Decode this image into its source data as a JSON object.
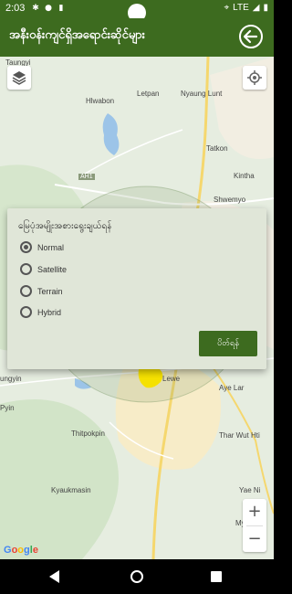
{
  "status_bar": {
    "time": "2:03",
    "network": "LTE"
  },
  "app_bar": {
    "title": "အနီးဝန်းကျင်ရှိအရောင်းဆိုင်များ"
  },
  "map": {
    "labels": [
      "Taungyi",
      "Hlwabon",
      "Letpan",
      "Nyaung Lunt",
      "Tatkon",
      "Kintha",
      "Shwemyo",
      "AH1",
      "Lewe",
      "Aye Lar",
      "Thar Wut Hti",
      "Thitpokpin",
      "Kyaukmasin",
      "Yae Ni",
      "Myohla",
      "ungyin",
      "Pyin"
    ],
    "zoom_in": "+",
    "zoom_out": "−",
    "attribution": "Google"
  },
  "dialog": {
    "title": "မြေပုံအမျိုးအစားရွေးချယ်ရန်",
    "options": [
      "Normal",
      "Satellite",
      "Terrain",
      "Hybrid"
    ],
    "selected": "Normal",
    "dismiss_label": "ပိတ်ရန်"
  },
  "colors": {
    "primary": "#3d6b1f",
    "dialog_bg": "#e0e6d8",
    "map_land": "#e9efe3",
    "road_yellow": "#f5d76e",
    "highlight": "#f5e100"
  }
}
